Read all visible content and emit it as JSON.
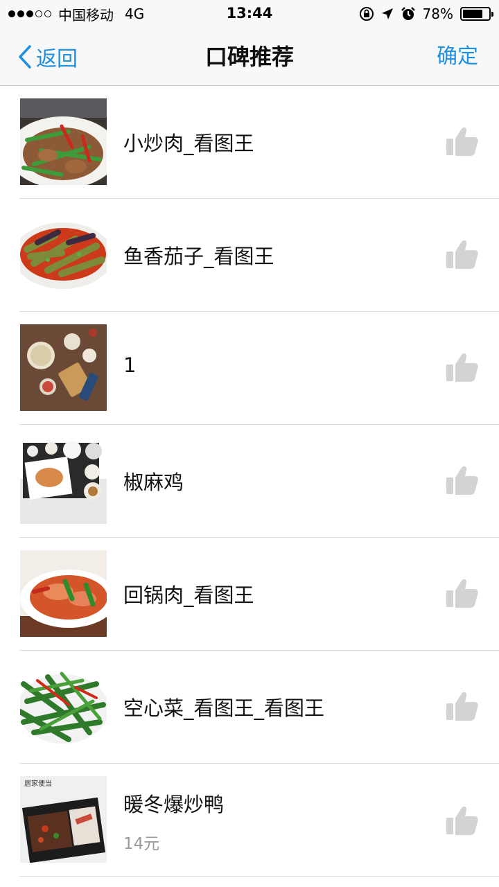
{
  "status_bar": {
    "carrier": "中国移动",
    "network": "4G",
    "time": "13:44",
    "battery_text": "78%",
    "battery_level": 0.78,
    "signal_bars_filled": 3,
    "signal_bars_total": 5
  },
  "nav": {
    "back_label": "返回",
    "title": "口碑推荐",
    "confirm_label": "确定"
  },
  "items": [
    {
      "name": "小炒肉_看图王",
      "price": ""
    },
    {
      "name": "鱼香茄子_看图王",
      "price": ""
    },
    {
      "name": "1",
      "price": ""
    },
    {
      "name": "椒麻鸡",
      "price": ""
    },
    {
      "name": "回锅肉_看图王",
      "price": ""
    },
    {
      "name": "空心菜_看图王_看图王",
      "price": ""
    },
    {
      "name": "暖冬爆炒鸭",
      "price": "14元"
    }
  ],
  "thumb_logo_text": "居家便当",
  "icons": {
    "back": "chevron-left-icon",
    "like": "thumbs-up-icon",
    "lock_rotation": "orientation-lock-icon",
    "location": "location-arrow-icon",
    "alarm": "alarm-clock-icon"
  },
  "colors": {
    "accent": "#1f8fe0",
    "like_icon": "#d3d3d3",
    "price": "#9a9a9a"
  }
}
